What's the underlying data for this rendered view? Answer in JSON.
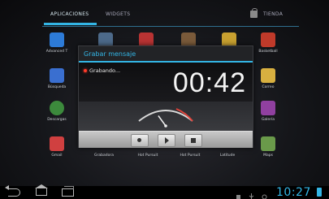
{
  "tabs": {
    "apps": "APLICACIONES",
    "widgets": "WIDGETS",
    "store": "TIENDA"
  },
  "apps": [
    {
      "label": "Advanced T",
      "color": "#2d7bd8"
    },
    {
      "label": "",
      "color": "#4d6a8a"
    },
    {
      "label": "",
      "color": "#b83333"
    },
    {
      "label": "",
      "color": "#7a5a3a"
    },
    {
      "label": "",
      "color": "#c8a030"
    },
    {
      "label": "Basketball",
      "color": "#c03a2a"
    },
    {
      "label": "Búsqueda",
      "color": "#3a6fd0"
    },
    {
      "label": "Correo",
      "color": "#d8b040"
    },
    {
      "label": "Descargas",
      "color": "#3c8a3c"
    },
    {
      "label": "Galería",
      "color": "#9040a0"
    },
    {
      "label": "Gmail",
      "color": "#d04040"
    },
    {
      "label": "Grabadora",
      "color": "#444"
    },
    {
      "label": "Hot Pursuit",
      "color": "#444"
    },
    {
      "label": "Hot Pursuit",
      "color": "#444"
    },
    {
      "label": "Latitude",
      "color": "#444"
    },
    {
      "label": "Maps",
      "color": "#6a9a4a"
    }
  ],
  "dialog": {
    "title": "Grabar mensaje",
    "status": "Grabando...",
    "timer": "00:42",
    "level_fraction": 0.35
  },
  "status_bar": {
    "clock": "10:27"
  },
  "colors": {
    "accent": "#33b5e5",
    "record": "#ff3a2a"
  }
}
